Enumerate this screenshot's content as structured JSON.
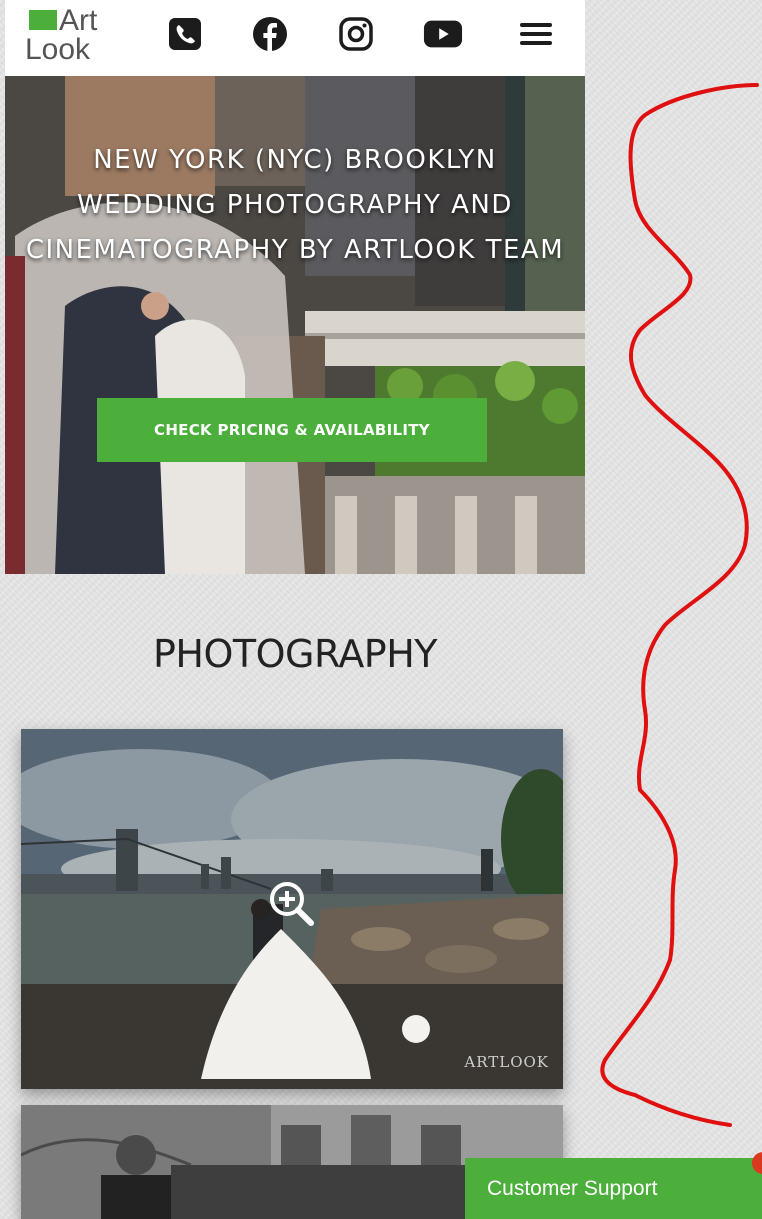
{
  "header": {
    "logo": {
      "line1": "Art",
      "line2": "Look"
    },
    "icons": [
      "phone-icon",
      "facebook-icon",
      "instagram-icon",
      "youtube-icon",
      "hamburger-menu-icon"
    ]
  },
  "hero": {
    "title": "NEW YORK (NYC) BROOKLYN WEDDING PHOTOGRAPHY AND CINEMATOGRAPHY BY ARTLOOK TEAM",
    "cta_label": "CHECK PRICING & AVAILABILITY"
  },
  "section": {
    "title": "PHOTOGRAPHY"
  },
  "photo1": {
    "watermark": "ARTLOOK"
  },
  "support": {
    "label": "Customer Support"
  },
  "colors": {
    "accent": "#4caf3c",
    "annotation": "#e01010",
    "notification": "#d9391f"
  }
}
